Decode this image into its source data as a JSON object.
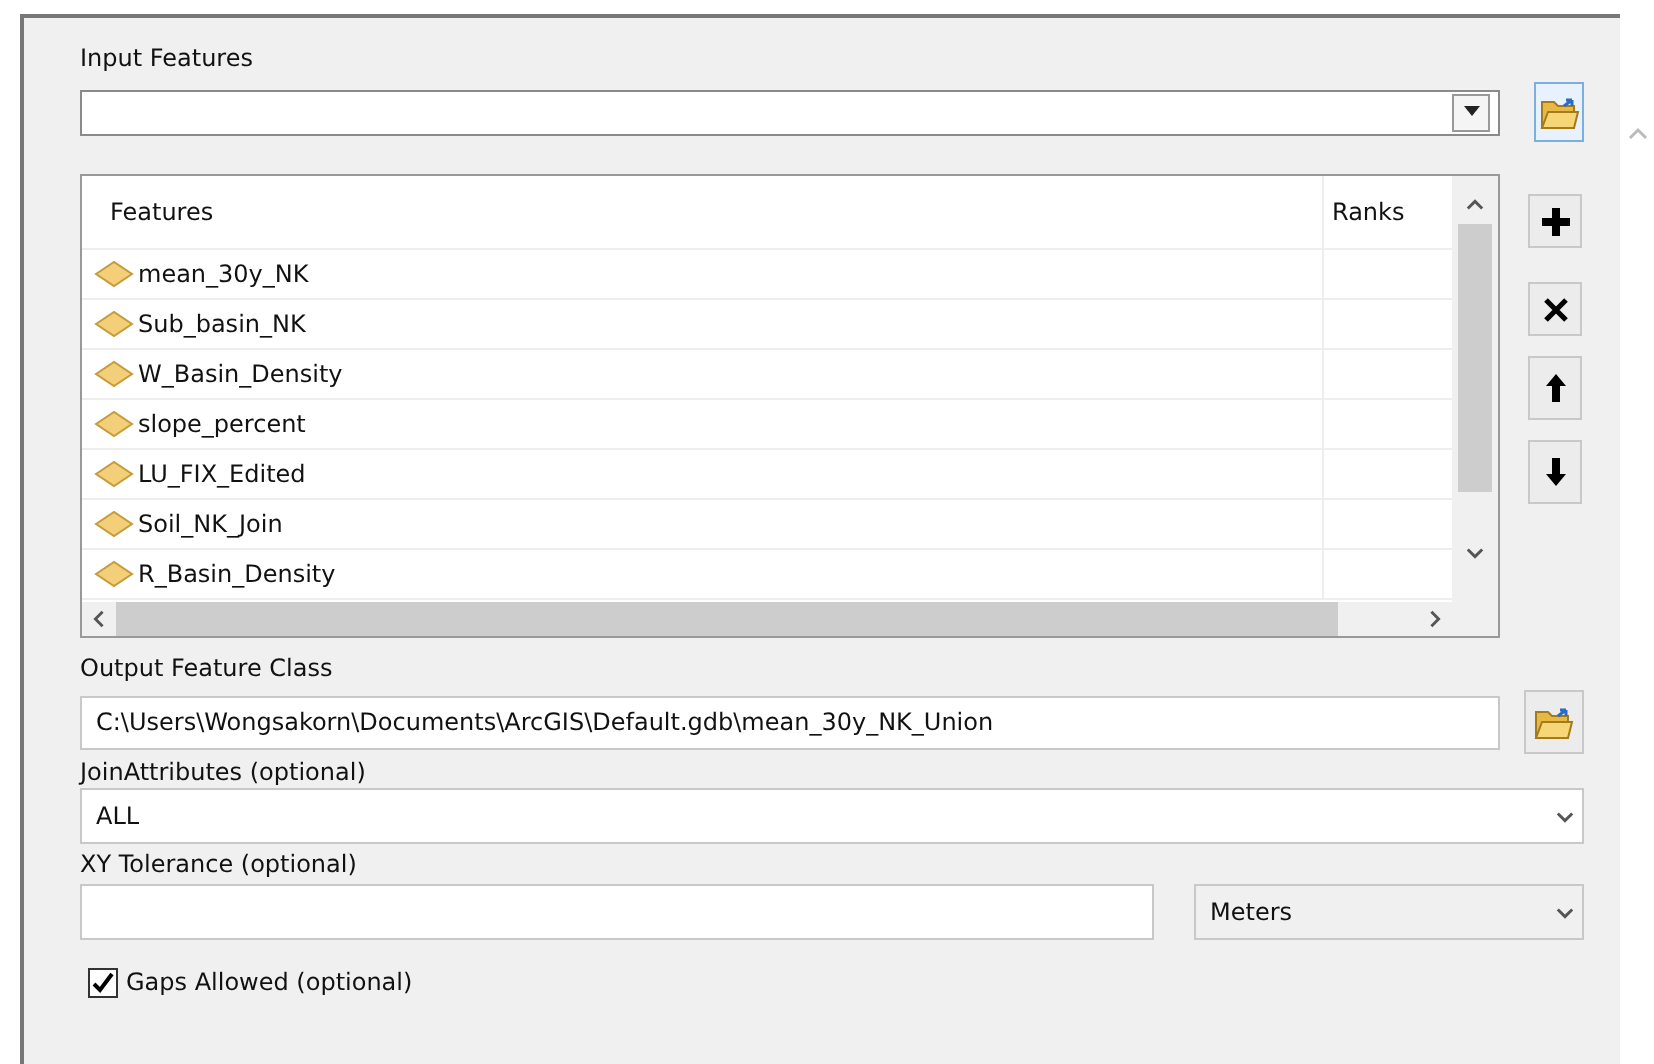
{
  "input_features": {
    "label": "Input Features"
  },
  "features_table": {
    "columns": [
      "Features",
      "Ranks"
    ],
    "rows": [
      {
        "name": "mean_30y_NK"
      },
      {
        "name": "Sub_basin_NK"
      },
      {
        "name": "W_Basin_Density"
      },
      {
        "name": "slope_percent"
      },
      {
        "name": "LU_FIX_Edited"
      },
      {
        "name": "Soil_NK_Join"
      },
      {
        "name": "R_Basin_Density"
      }
    ]
  },
  "output_feature_class": {
    "label": "Output Feature Class",
    "value": "C:\\Users\\Wongsakorn\\Documents\\ArcGIS\\Default.gdb\\mean_30y_NK_Union"
  },
  "join_attributes": {
    "label": "JoinAttributes (optional)",
    "value": "ALL"
  },
  "xy_tolerance": {
    "label": "XY Tolerance (optional)",
    "unit": "Meters"
  },
  "gaps_allowed": {
    "label": "Gaps Allowed (optional)",
    "checked": true
  }
}
